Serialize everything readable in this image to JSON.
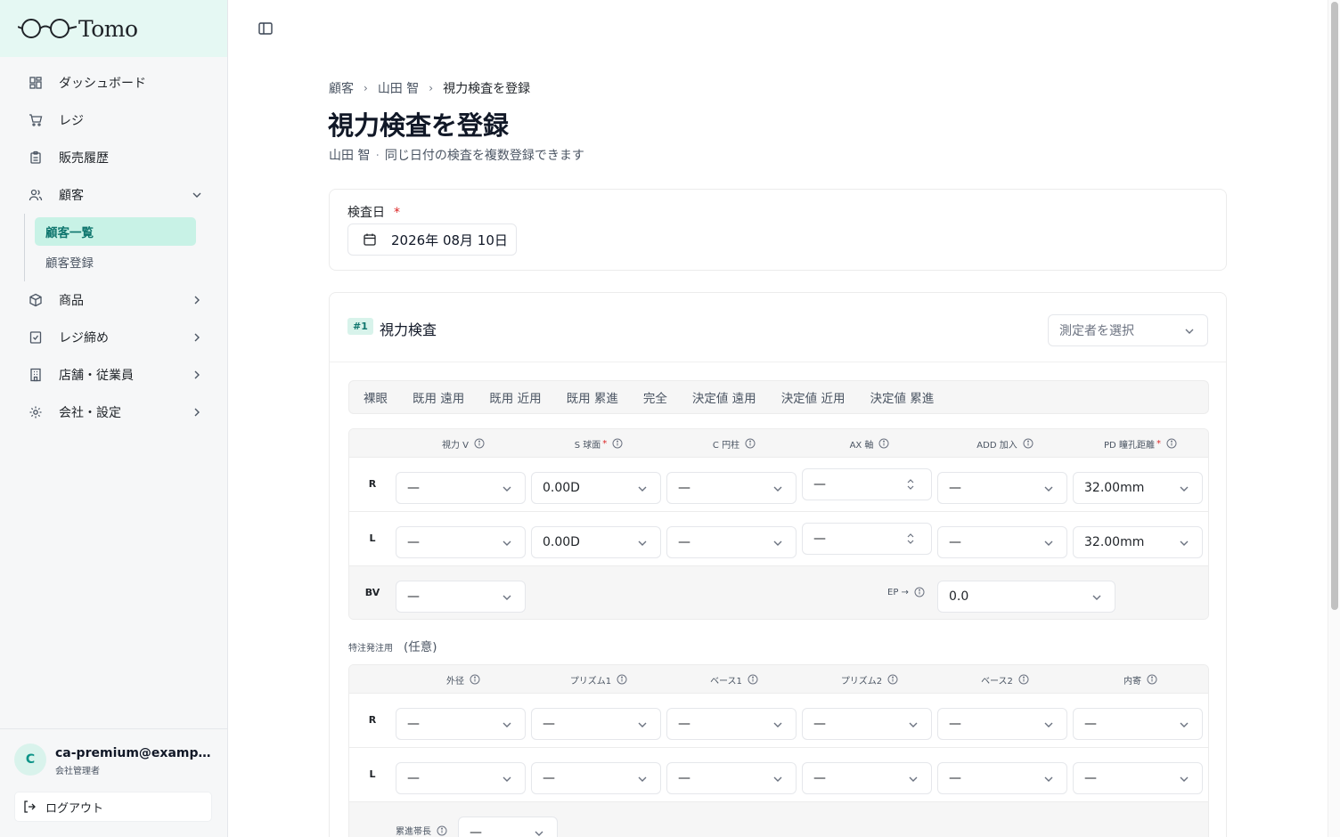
{
  "brand": {
    "name": "Tomo"
  },
  "sidebar": {
    "items": [
      {
        "label": "ダッシュボード",
        "icon": "dashboard-icon"
      },
      {
        "label": "レジ",
        "icon": "cart-icon"
      },
      {
        "label": "販売履歴",
        "icon": "clipboard-icon"
      },
      {
        "label": "顧客",
        "icon": "users-icon"
      },
      {
        "label": "商品",
        "icon": "box-icon"
      },
      {
        "label": "レジ締め",
        "icon": "register-close-icon"
      },
      {
        "label": "店舗・従業員",
        "icon": "building-icon"
      },
      {
        "label": "会社・設定",
        "icon": "gear-icon"
      }
    ],
    "customer_sub": [
      {
        "label": "顧客一覧",
        "active": true
      },
      {
        "label": "顧客登録",
        "active": false
      }
    ]
  },
  "user": {
    "initial": "C",
    "email": "ca-premium@example.com",
    "role": "会社管理者",
    "logout": "ログアウト"
  },
  "breadcrumb": [
    "顧客",
    "山田 智",
    "視力検査を登録"
  ],
  "page": {
    "title": "視力検査を登録",
    "customer": "山田 智",
    "dot": "·",
    "subtitle": "同じ日付の検査を複数登録できます"
  },
  "exam_date": {
    "label": "検査日",
    "required": "*",
    "value": "2026年 08月 10日"
  },
  "exam": {
    "number": "#1",
    "title": "視力検査",
    "measurer_placeholder": "測定者を選択",
    "tabs": [
      "裸眼",
      "既用 遠用",
      "既用 近用",
      "既用 累進",
      "完全",
      "決定値 遠用",
      "決定値 近用",
      "決定値 累進"
    ],
    "columns": [
      "視力 V",
      "S 球面",
      "C 円柱",
      "AX 軸",
      "ADD 加入",
      "PD 瞳孔距離"
    ],
    "required_mark": "*",
    "rows": [
      {
        "label": "R",
        "values": [
          "—",
          "0.00D",
          "—",
          "—",
          "—",
          "32.00mm"
        ]
      },
      {
        "label": "L",
        "values": [
          "—",
          "0.00D",
          "—",
          "—",
          "—",
          "32.00mm"
        ]
      }
    ],
    "bv": {
      "label": "BV",
      "value": "—"
    },
    "ep": {
      "label": "EP →",
      "value": "0.0"
    },
    "optional": {
      "label": "特注発注用",
      "note": "(任意)"
    },
    "opt_columns": [
      "外径",
      "プリズム1",
      "ベース1",
      "プリズム2",
      "ベース2",
      "内寄"
    ],
    "opt_rows": [
      {
        "label": "R",
        "values": [
          "—",
          "—",
          "—",
          "—",
          "—",
          "—"
        ]
      },
      {
        "label": "L",
        "values": [
          "—",
          "—",
          "—",
          "—",
          "—",
          "—"
        ]
      }
    ],
    "progressive": {
      "label": "累進帯長",
      "value": "—"
    }
  }
}
